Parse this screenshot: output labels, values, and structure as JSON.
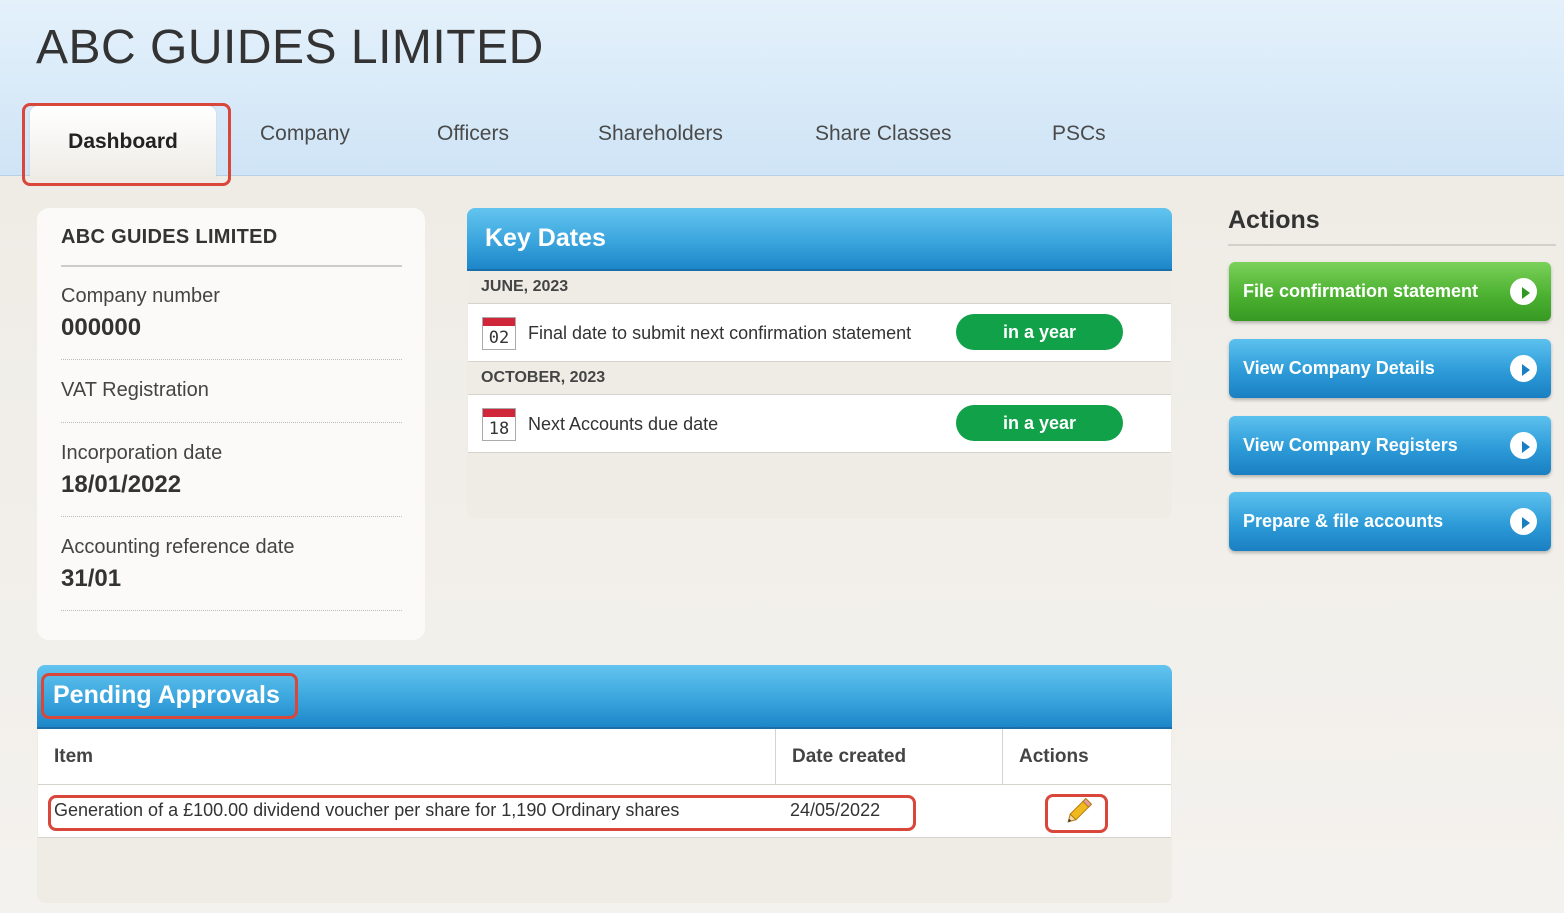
{
  "header": {
    "company_name": "ABC GUIDES LIMITED"
  },
  "tabs": [
    {
      "label": "Dashboard",
      "active": true
    },
    {
      "label": "Company"
    },
    {
      "label": "Officers"
    },
    {
      "label": "Shareholders"
    },
    {
      "label": "Share Classes"
    },
    {
      "label": "PSCs"
    }
  ],
  "company_card": {
    "title": "ABC GUIDES LIMITED",
    "fields": [
      {
        "label": "Company number",
        "value": "000000"
      },
      {
        "label": "VAT Registration",
        "value": ""
      },
      {
        "label": "Incorporation date",
        "value": "18/01/2022"
      },
      {
        "label": "Accounting reference date",
        "value": "31/01"
      }
    ]
  },
  "key_dates": {
    "title": "Key Dates",
    "groups": [
      {
        "month": "JUNE, 2023",
        "day": "02",
        "text": "Final date to submit next confirmation statement",
        "status": "in a year"
      },
      {
        "month": "OCTOBER, 2023",
        "day": "18",
        "text": "Next Accounts due date",
        "status": "in a year"
      }
    ]
  },
  "actions": {
    "title": "Actions",
    "buttons": [
      {
        "label": "File confirmation statement",
        "color": "#4db232"
      },
      {
        "label": "View Company Details",
        "color": "#2d9bd8"
      },
      {
        "label": "View Company Registers",
        "color": "#2d9bd8"
      },
      {
        "label": "Prepare & file accounts",
        "color": "#2d9bd8"
      }
    ]
  },
  "pending_approvals": {
    "title": "Pending Approvals",
    "columns": [
      "Item",
      "Date created",
      "Actions"
    ],
    "rows": [
      {
        "item": "Generation of a £100.00 dividend voucher per share for 1,190 Ordinary shares",
        "date_created": "24/05/2022",
        "action_icon": "pencil-icon"
      }
    ]
  },
  "colors": {
    "accent_blue": "#2d9bd8",
    "accent_green": "#4db232",
    "status_green": "#10a149",
    "highlight_red": "#d9463a"
  }
}
